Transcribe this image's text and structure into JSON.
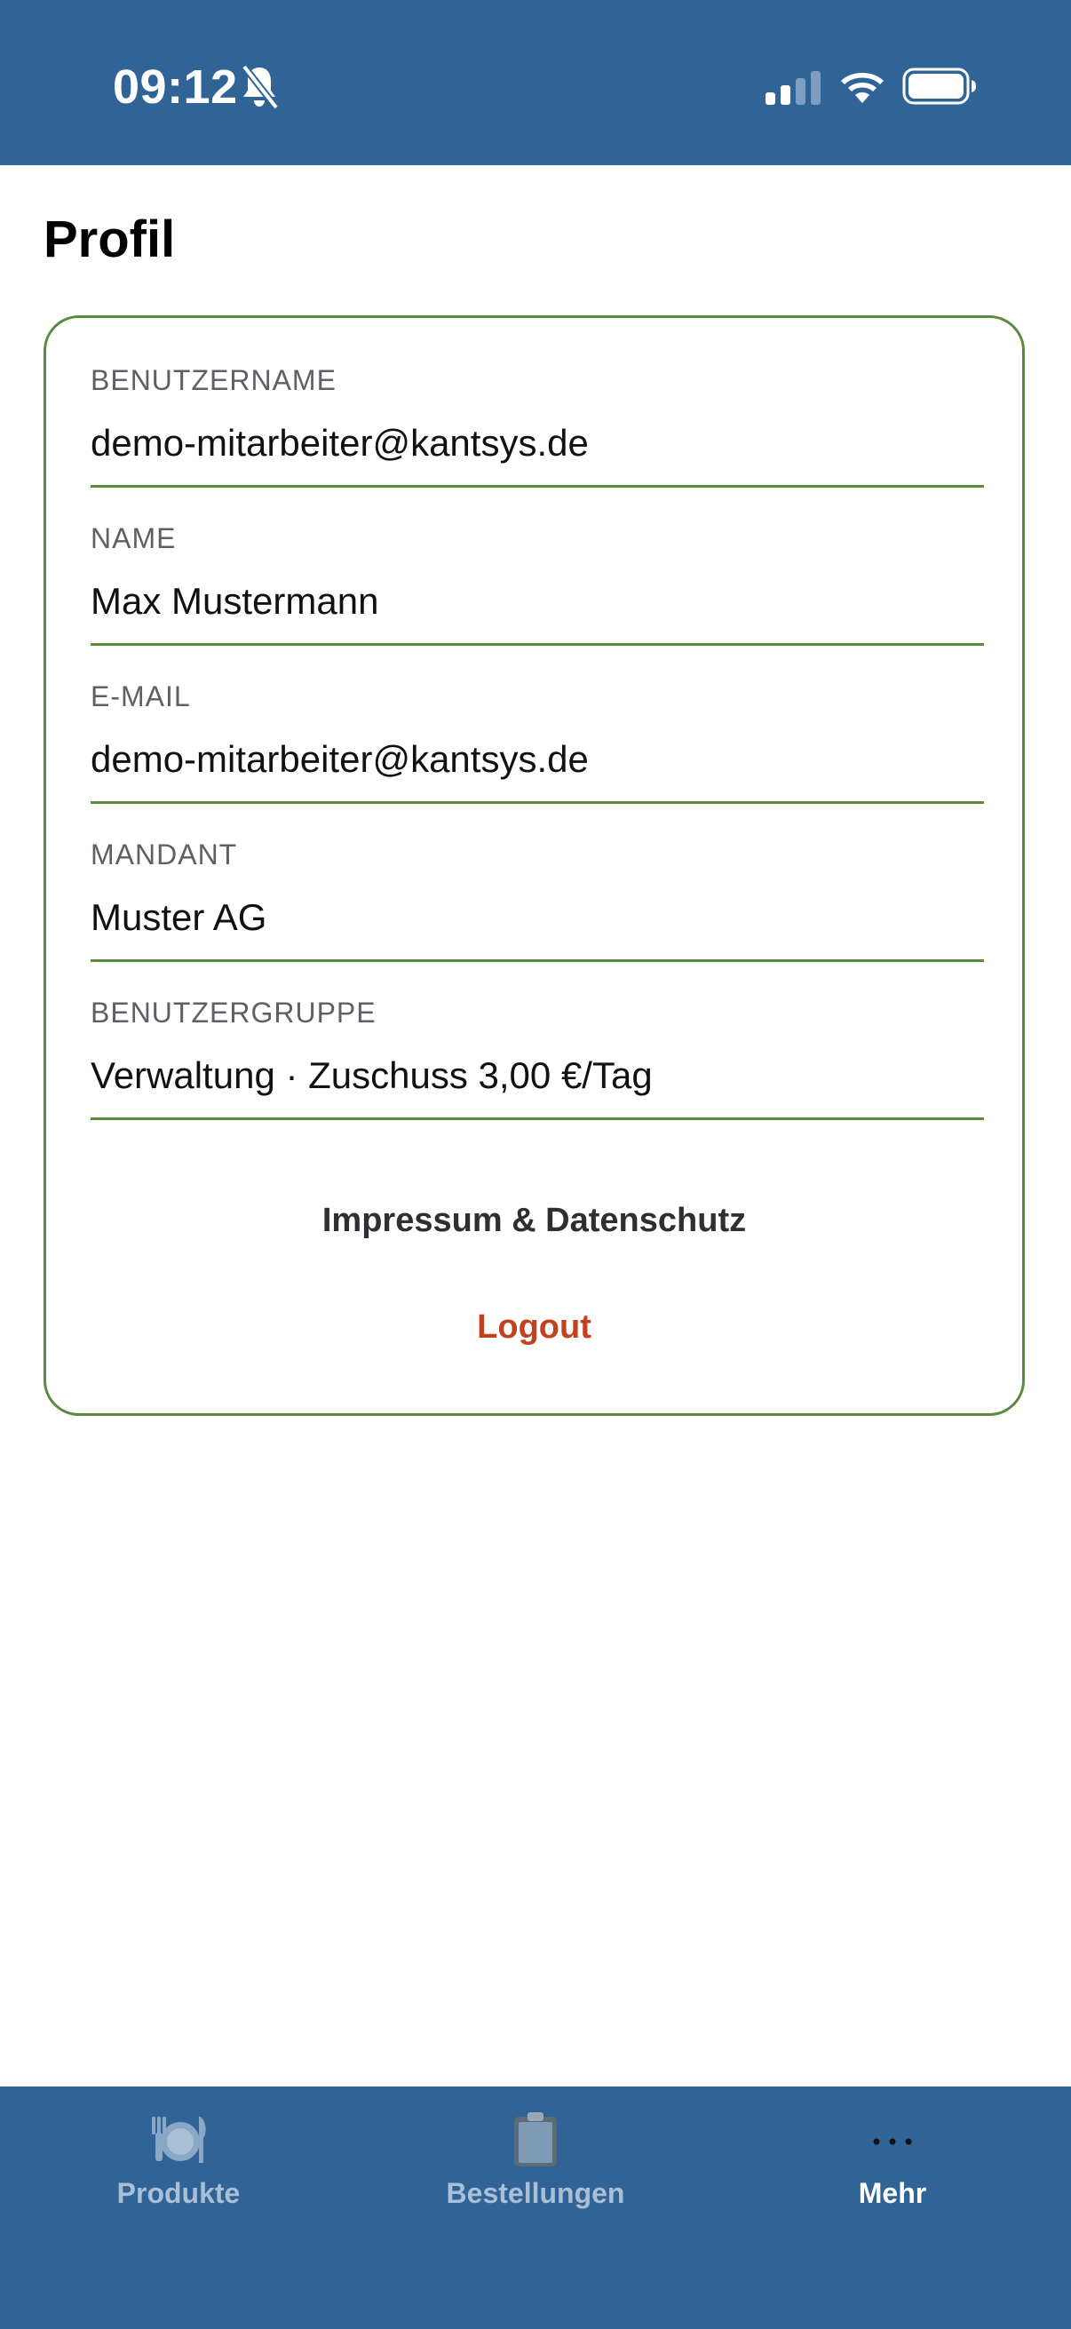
{
  "status_bar": {
    "time": "09:12",
    "background": "#306497",
    "icons": [
      "bell-muted-icon",
      "cellular-signal-icon",
      "wifi-icon",
      "battery-icon"
    ]
  },
  "page": {
    "title": "Profil"
  },
  "profile": {
    "fields": [
      {
        "label": "BENUTZERNAME",
        "value": "demo-mitarbeiter@kantsys.de"
      },
      {
        "label": "NAME",
        "value": "Max Mustermann"
      },
      {
        "label": "E-MAIL",
        "value": "demo-mitarbeiter@kantsys.de"
      },
      {
        "label": "MANDANT",
        "value": "Muster AG"
      },
      {
        "label": "BENUTZERGRUPPE",
        "value": "Verwaltung · Zuschuss 3,00 €/Tag"
      }
    ],
    "imprint_link": "Impressum & Datenschutz",
    "logout_link": "Logout",
    "accent_color": "#5a8a3e",
    "logout_color": "#c2411e"
  },
  "tab_bar": {
    "tabs": [
      {
        "label": "Produkte",
        "icon": "plate-cutlery-icon",
        "active": false
      },
      {
        "label": "Bestellungen",
        "icon": "clipboard-icon",
        "active": false
      },
      {
        "label": "Mehr",
        "icon": "more-dots-icon",
        "active": true
      }
    ]
  }
}
